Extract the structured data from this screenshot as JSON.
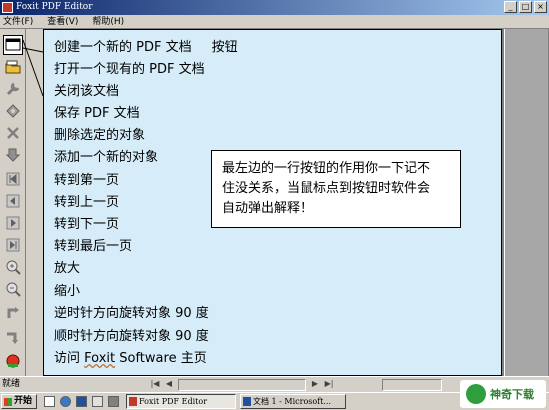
{
  "window": {
    "title": "Foxit PDF Editor"
  },
  "menu": {
    "items": [
      "文件(F)",
      "查看(V)",
      "帮助(H)"
    ]
  },
  "toolbar_icons": [
    "new-document-icon",
    "open-folder-icon",
    "close-wrench-icon",
    "save-icon",
    "delete-x-icon",
    "add-object-hand-icon",
    "first-page-icon",
    "previous-page-icon",
    "next-page-icon",
    "last-page-icon",
    "zoom-in-icon",
    "zoom-out-icon",
    "rotate-ccw-icon",
    "rotate-cw-icon",
    "foxit-home-icon"
  ],
  "items": [
    "创建一个新的 PDF 文档",
    "打开一个现有的 PDF 文档",
    "关闭该文档",
    "保存 PDF 文档",
    "删除选定的对象",
    "添加一个新的对象",
    "转到第一页",
    "转到上一页",
    "转到下一页",
    "转到最后一页",
    "放大",
    "缩小",
    "逆时针方向旋转对象 90 度",
    "顺时针方向旋转对象 90 度"
  ],
  "first_suffix": "按钮",
  "last_item_prefix": "访问 ",
  "last_item_brand": "Foxit",
  "last_item_suffix": " Software 主页",
  "callout": {
    "lines": [
      "最左边的一行按钮的作用你一下记不",
      "住没关系，当鼠标点到按钮时软件会",
      "自动弹出解释！"
    ]
  },
  "status": {
    "text": "就绪"
  },
  "taskbar": {
    "start": "开始",
    "tasks": [
      "Foxit PDF Editor",
      "文档 1 - Microsoft..."
    ]
  },
  "watermark": {
    "text": "神奇下载"
  }
}
